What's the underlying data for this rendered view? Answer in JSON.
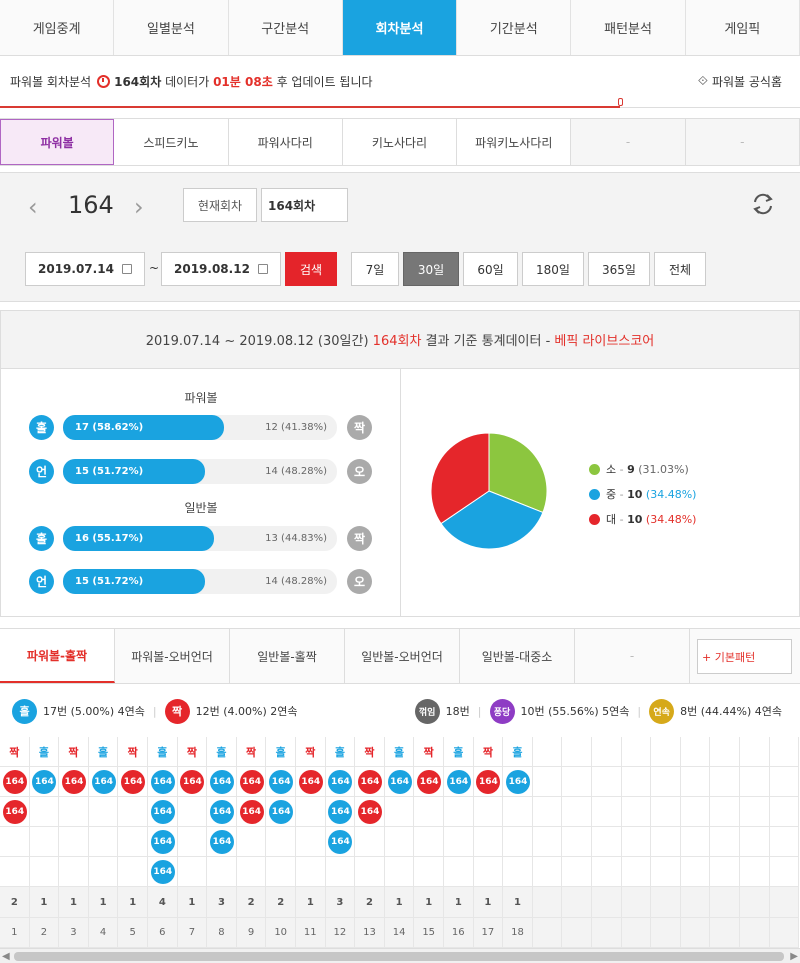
{
  "top_nav": {
    "tabs": [
      "게임중계",
      "일별분석",
      "구간분석",
      "회차분석",
      "기간분석",
      "패턴분석",
      "게임픽"
    ],
    "active": 3
  },
  "timer": {
    "prefix": "파워볼 회차분석",
    "round": "164회차",
    "mid": "데이터가",
    "remaining": "01분 08초",
    "suffix": "후 업데이트 됩니다",
    "official_link": "파워볼 공식홈",
    "progress_fraction": 0.775
  },
  "game_nav": {
    "tabs": [
      "파워볼",
      "스피드키노",
      "파워사다리",
      "키노사다리",
      "파워키노사다리",
      "-",
      "-"
    ],
    "active": 0
  },
  "round_nav": {
    "current": "164",
    "prev": "‹",
    "next": "›",
    "current_btn": "현재회차",
    "round_field": "164회차"
  },
  "date_range": {
    "start": "2019.07.14",
    "tilde": "~",
    "end": "2019.08.12",
    "search": "검색",
    "periods": [
      "7일",
      "30일",
      "60일",
      "180일",
      "365일",
      "전체"
    ],
    "active_period": 1
  },
  "stats": {
    "head_range": "2019.07.14 ~ 2019.08.12 (30일간)",
    "head_round": "164회차",
    "head_mid": "결과 기준 통계데이터 -",
    "head_source": "베픽 라이브스코어",
    "powerball_label": "파워볼",
    "normal_label": "일반볼",
    "bars": [
      {
        "left_icon": "홀",
        "left_text": "17 (58.62%)",
        "left_fraction": 0.5862,
        "right_text": "12 (41.38%)",
        "right_icon": "짝"
      },
      {
        "left_icon": "언",
        "left_text": "15 (51.72%)",
        "left_fraction": 0.5172,
        "right_text": "14 (48.28%)",
        "right_icon": "오"
      },
      {
        "left_icon": "홀",
        "left_text": "16 (55.17%)",
        "left_fraction": 0.5517,
        "right_text": "13 (44.83%)",
        "right_icon": "짝"
      },
      {
        "left_icon": "언",
        "left_text": "15 (51.72%)",
        "left_fraction": 0.5172,
        "right_text": "14 (48.28%)",
        "right_icon": "오"
      }
    ]
  },
  "chart_data": {
    "type": "pie",
    "slices": [
      {
        "label": "소",
        "value": 9,
        "pct": "(31.03%)",
        "color": "#8cc63f"
      },
      {
        "label": "중",
        "value": 10,
        "pct": "(34.48%)",
        "color": "#1aa3e0"
      },
      {
        "label": "대",
        "value": 10,
        "pct": "(34.48%)",
        "color": "#e5262b"
      }
    ],
    "sep": "-"
  },
  "pattern_tabs": {
    "tabs": [
      "파워볼-홀짝",
      "파워볼-오버언더",
      "일반볼-홀짝",
      "일반볼-오버언더",
      "일반볼-대중소",
      "-"
    ],
    "active": 0,
    "basic_btn": "+ 기본패턴"
  },
  "summary": {
    "odd_icon": "홀",
    "odd_text": "17번 (5.00%) 4연속",
    "even_icon": "짝",
    "even_text": "12번 (4.00%) 2연속",
    "break_icon": "꺾임",
    "break_text": "18번",
    "bounce_icon": "퐁당",
    "bounce_text": "10번 (55.56%) 5연속",
    "streak_icon": "연속",
    "streak_text": "8번 (44.44%) 4연속"
  },
  "grid": {
    "ball_label": "164",
    "columns": [
      {
        "h": "짝",
        "n": 2
      },
      {
        "h": "홀",
        "n": 1
      },
      {
        "h": "짝",
        "n": 1
      },
      {
        "h": "홀",
        "n": 1
      },
      {
        "h": "짝",
        "n": 1
      },
      {
        "h": "홀",
        "n": 4
      },
      {
        "h": "짝",
        "n": 1
      },
      {
        "h": "홀",
        "n": 3
      },
      {
        "h": "짝",
        "n": 2
      },
      {
        "h": "홀",
        "n": 2
      },
      {
        "h": "짝",
        "n": 1
      },
      {
        "h": "홀",
        "n": 3
      },
      {
        "h": "짝",
        "n": 2
      },
      {
        "h": "홀",
        "n": 1
      },
      {
        "h": "짝",
        "n": 1
      },
      {
        "h": "홀",
        "n": 1
      },
      {
        "h": "짝",
        "n": 1
      },
      {
        "h": "홀",
        "n": 1
      }
    ],
    "indices": [
      "1",
      "2",
      "3",
      "4",
      "5",
      "6",
      "7",
      "8",
      "9",
      "10",
      "11",
      "12",
      "13",
      "14",
      "15",
      "16",
      "17",
      "18"
    ],
    "colors": {
      "odd": "#1aa3e0",
      "even": "#e5262b"
    },
    "total_cols": 27,
    "rows": 5
  },
  "scroll": {
    "left": "◀",
    "right": "▶"
  }
}
